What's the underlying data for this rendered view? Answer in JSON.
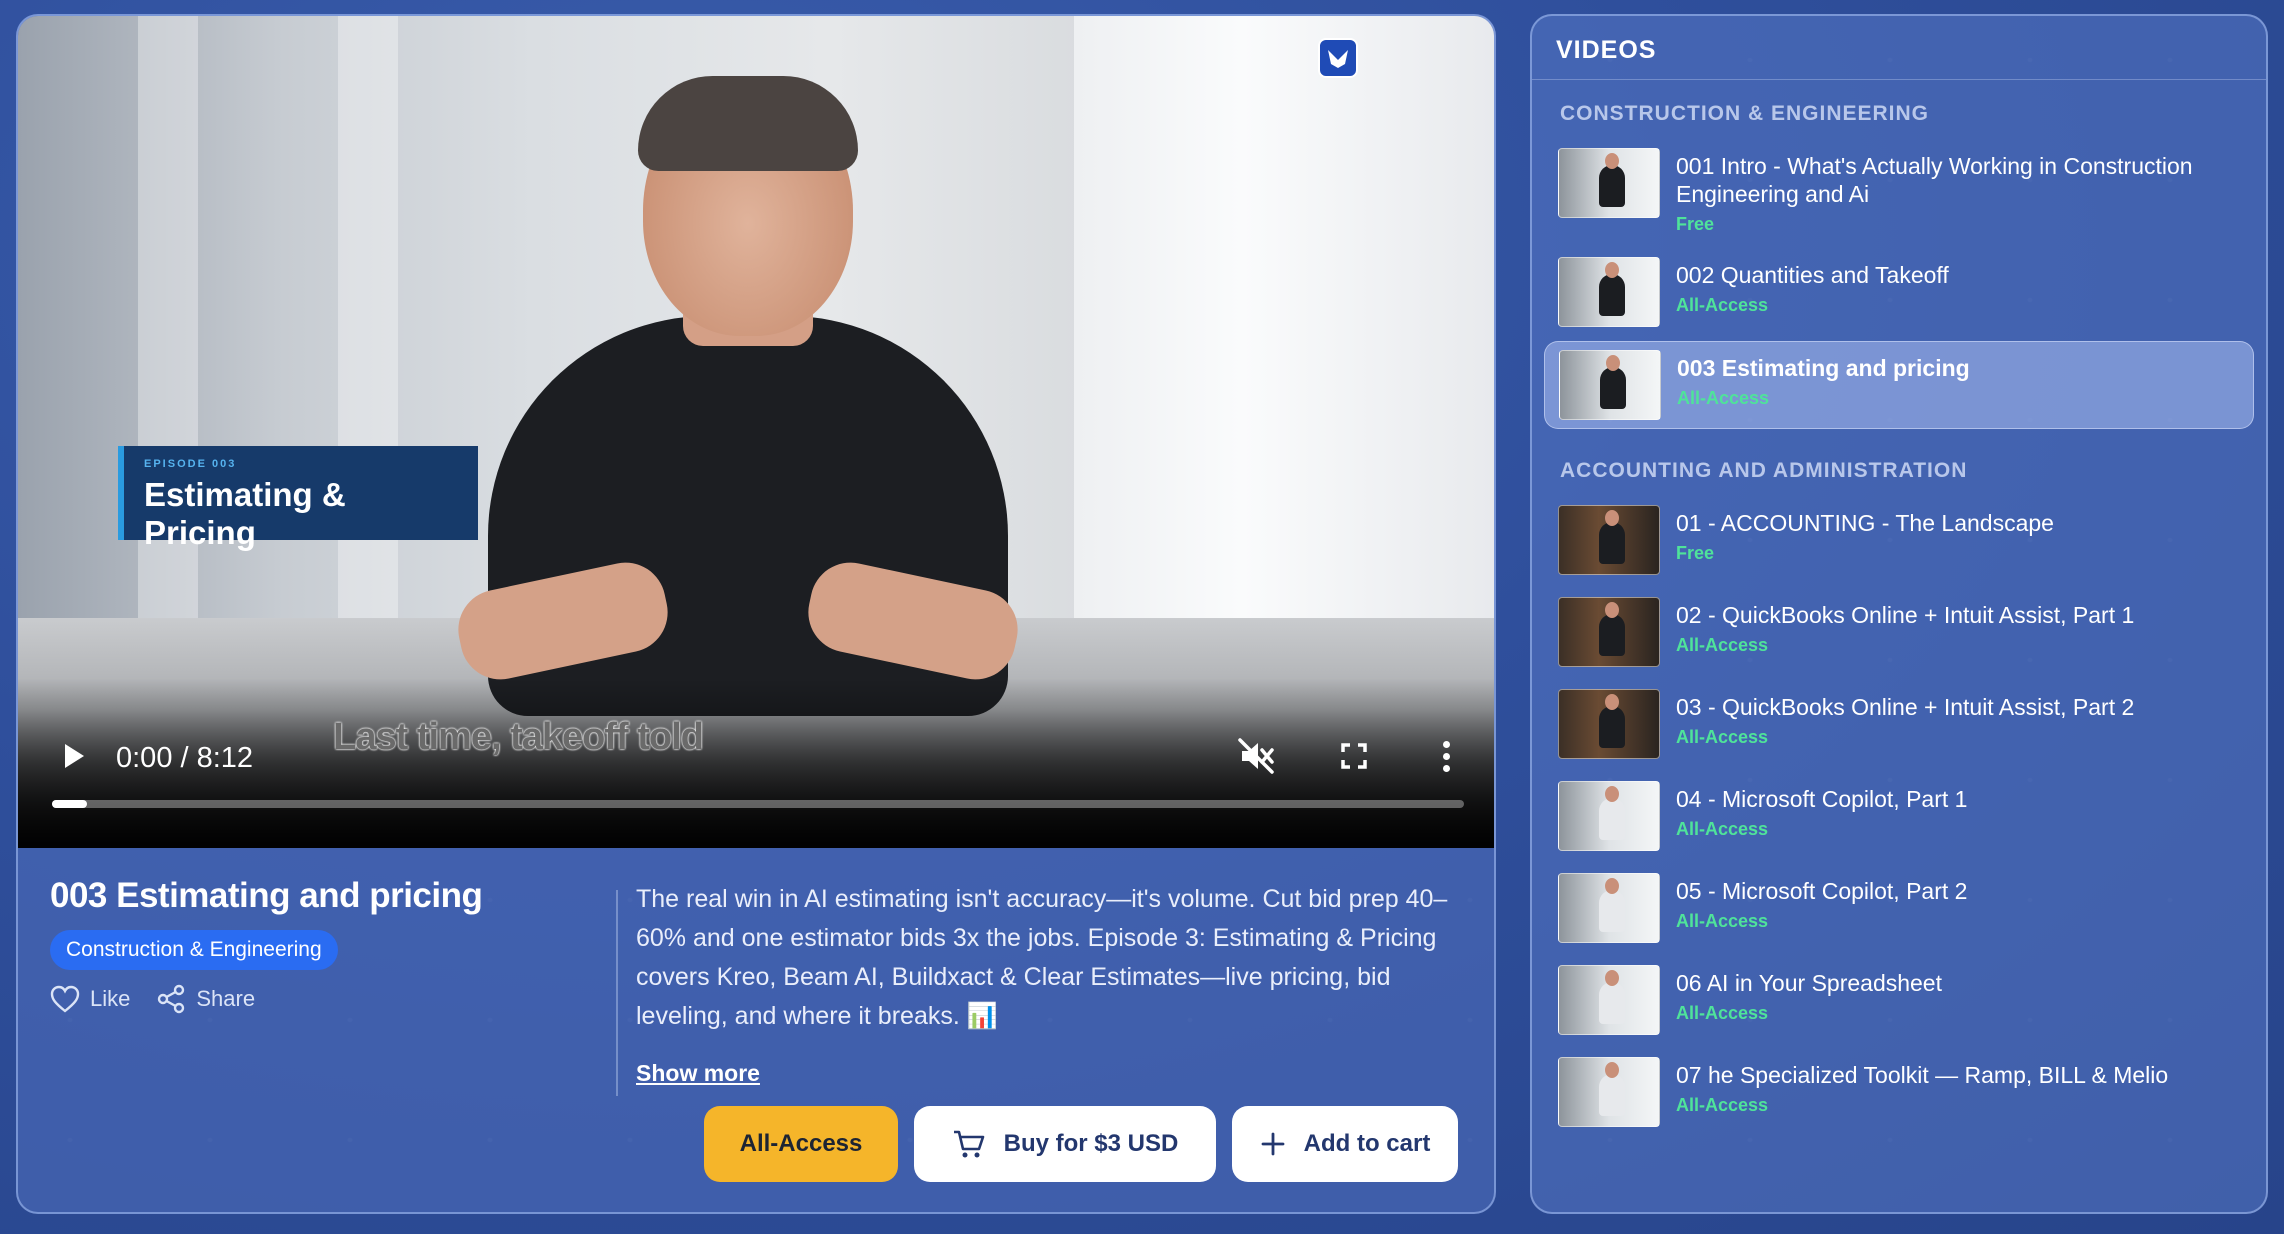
{
  "player": {
    "episode_small": "EPISODE 003",
    "episode_title": "Estimating & Pricing",
    "caption": "Last time, takeoff told",
    "time": "0:00 / 8:12",
    "progress_fraction": 0.025,
    "logo_glyph": "✕"
  },
  "video": {
    "title": "003 Estimating and pricing",
    "category": "Construction & Engineering",
    "like_label": "Like",
    "share_label": "Share",
    "description": "The real win in AI estimating isn't accuracy—it's volume. Cut bid prep 40–60% and one estimator bids 3x the jobs. Episode 3: Estimating & Pricing covers Kreo, Beam AI, Buildxact & Clear Estimates—live pricing, bid leveling, and where it breaks. 📊",
    "show_more": "Show more"
  },
  "buttons": {
    "all_access": "All-Access",
    "buy": "Buy for $3 USD",
    "add_to_cart": "Add to cart"
  },
  "sidebar": {
    "header": "VIDEOS",
    "sections": [
      {
        "title": "CONSTRUCTION & ENGINEERING",
        "items": [
          {
            "title": "001 Intro - What's Actually Working in Construction Engineering and Ai",
            "access": "Free"
          },
          {
            "title": "002 Quantities and Takeoff",
            "access": "All-Access"
          },
          {
            "title": "003 Estimating and pricing",
            "access": "All-Access"
          }
        ]
      },
      {
        "title": "ACCOUNTING AND ADMINISTRATION",
        "items": [
          {
            "title": "01 - ACCOUNTING - The Landscape",
            "access": "Free"
          },
          {
            "title": "02 - QuickBooks Online + Intuit Assist, Part 1",
            "access": "All-Access"
          },
          {
            "title": "03 - QuickBooks Online + Intuit Assist, Part 2",
            "access": "All-Access"
          },
          {
            "title": "04 - Microsoft Copilot, Part 1",
            "access": "All-Access"
          },
          {
            "title": "05 - Microsoft Copilot, Part 2",
            "access": "All-Access"
          },
          {
            "title": "06 AI in Your Spreadsheet",
            "access": "All-Access"
          },
          {
            "title": "07 he Specialized Toolkit — Ramp, BILL & Melio",
            "access": "All-Access"
          }
        ]
      }
    ]
  },
  "colors": {
    "accent_blue": "#2a6cf2",
    "all_access_yellow": "#f5b52a",
    "access_green": "#4fe39a"
  }
}
